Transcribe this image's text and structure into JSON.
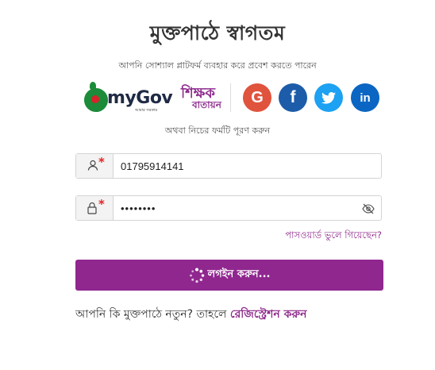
{
  "page": {
    "title": "মুক্তপাঠে স্বাগতম",
    "subtitle": "আপনি সোশ্যাল প্লাটফর্ম ব্যবহার করে প্রবেশ করতে পারেন",
    "or_text": "অথবা নিচের ফর্মটি পূরণ করুন"
  },
  "social": {
    "mygov_label": "myGov",
    "mygov_tagline": "আমার সরকার",
    "shikkhok_top": "শিক্ষক",
    "shikkhok_bottom": "বাতায়ন",
    "google_letter": "G",
    "facebook_letter": "f",
    "linkedin_letter": "in",
    "colors": {
      "google": "#e0533d",
      "facebook": "#1d5ca9",
      "twitter": "#1da1f2",
      "linkedin": "#0a66c2"
    }
  },
  "form": {
    "phone_value": "01795914141",
    "password_value": "••••••••",
    "required_mark": "*",
    "forgot_link": "পাসওয়ার্ড ভুলে গিয়েছেন?",
    "login_button": "লগইন করুন..."
  },
  "footer": {
    "register_prompt": "আপনি কি মুক্তপাঠে নতুন? তাহলে ",
    "register_link": "রেজিস্ট্রেশন করুন"
  },
  "theme": {
    "accent": "#90278f",
    "required": "#e02424"
  }
}
